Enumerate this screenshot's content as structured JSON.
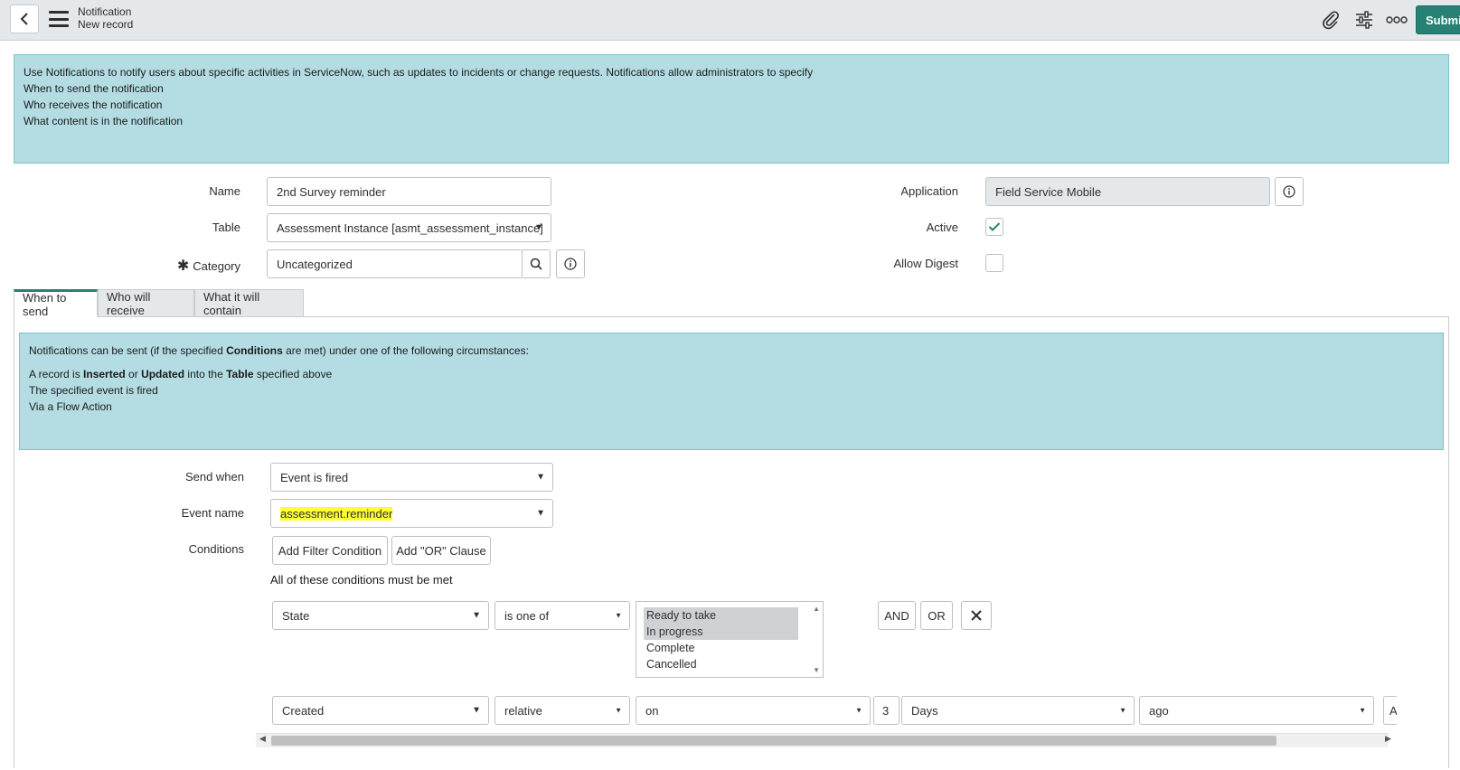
{
  "header": {
    "title": "Notification",
    "subtitle": "New record",
    "submit_label": "Submit",
    "icons": [
      "back-icon",
      "menu-icon",
      "paperclip-icon",
      "settings-sliders-icon",
      "more-icon"
    ]
  },
  "intro": {
    "line1": "Use Notifications to notify users about specific activities in ServiceNow, such as updates to incidents or change requests. Notifications allow administrators to specify",
    "line2": "When to send the notification",
    "line3": "Who receives the notification",
    "line4": "What content is in the notification"
  },
  "form": {
    "name_label": "Name",
    "name_value": "2nd Survey reminder",
    "table_label": "Table",
    "table_value": "Assessment Instance [asmt_assessment_instance]",
    "category_label": "Category",
    "category_required": "✱",
    "category_value": "Uncategorized",
    "application_label": "Application",
    "application_value": "Field Service Mobile",
    "active_label": "Active",
    "active_checked": true,
    "allow_digest_label": "Allow Digest",
    "allow_digest_checked": false
  },
  "tabs": [
    {
      "label": "When to send",
      "active": true
    },
    {
      "label": "Who will receive",
      "active": false
    },
    {
      "label": "What it will contain",
      "active": false
    }
  ],
  "when_info": {
    "l1_a": "Notifications can be sent (if the specified ",
    "l1_b": "Conditions",
    "l1_c": " are met) under one of the following circumstances:",
    "l2_a": "A record is ",
    "l2_b": "Inserted",
    "l2_c": " or ",
    "l2_d": "Updated",
    "l2_e": " into the ",
    "l2_f": "Table",
    "l2_g": " specified above",
    "l3": "The specified event is fired",
    "l4": "Via a Flow Action"
  },
  "send": {
    "send_when_label": "Send when",
    "send_when_value": "Event is fired",
    "event_name_label": "Event name",
    "event_name_value": "assessment.reminder",
    "conditions_label": "Conditions",
    "add_filter_label": "Add Filter Condition",
    "add_or_label": "Add \"OR\" Clause",
    "all_conditions_text": "All of these conditions must be met"
  },
  "condition1": {
    "field": "State",
    "operator": "is one of",
    "options": [
      {
        "label": "Ready to take",
        "selected": true
      },
      {
        "label": "In progress",
        "selected": true
      },
      {
        "label": "Complete",
        "selected": false
      },
      {
        "label": "Cancelled",
        "selected": false
      }
    ],
    "and_label": "AND",
    "or_label": "OR"
  },
  "condition2": {
    "field": "Created",
    "operator": "relative",
    "when": "on",
    "amount": "3",
    "unit": "Days",
    "direction": "ago",
    "trailing": "A"
  }
}
